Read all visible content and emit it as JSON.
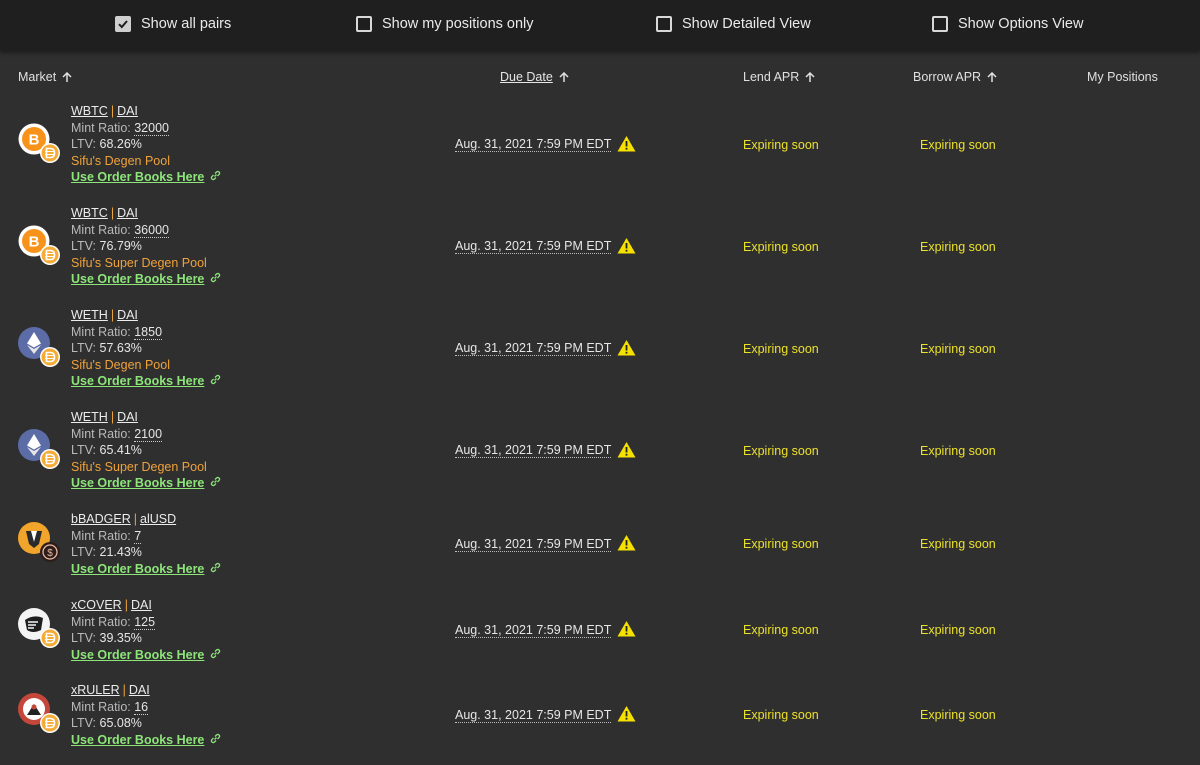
{
  "filters": [
    {
      "label": "Show all pairs",
      "checked": true
    },
    {
      "label": "Show my positions only",
      "checked": false
    },
    {
      "label": "Show Detailed View",
      "checked": false
    },
    {
      "label": "Show Options View",
      "checked": false
    }
  ],
  "columns": {
    "market": "Market",
    "due_date": "Due Date",
    "lend_apr": "Lend APR",
    "borrow_apr": "Borrow APR",
    "my_positions": "My Positions"
  },
  "rows": [
    {
      "base": "WBTC",
      "quote": "DAI",
      "mint_label": "Mint Ratio:",
      "mint_ratio": "32000",
      "ltv_label": "LTV:",
      "ltv": "68.26%",
      "pool": "Sifu's Degen Pool",
      "order_books": "Use Order Books Here",
      "due": "Aug. 31, 2021 7:59 PM EDT",
      "lend": "Expiring soon",
      "borrow": "Expiring soon",
      "base_icon": "bitcoin-icon",
      "quote_icon": "dai-icon"
    },
    {
      "base": "WBTC",
      "quote": "DAI",
      "mint_label": "Mint Ratio:",
      "mint_ratio": "36000",
      "ltv_label": "LTV:",
      "ltv": "76.79%",
      "pool": "Sifu's Super Degen Pool",
      "order_books": "Use Order Books Here",
      "due": "Aug. 31, 2021 7:59 PM EDT",
      "lend": "Expiring soon",
      "borrow": "Expiring soon",
      "base_icon": "bitcoin-icon",
      "quote_icon": "dai-icon"
    },
    {
      "base": "WETH",
      "quote": "DAI",
      "mint_label": "Mint Ratio:",
      "mint_ratio": "1850",
      "ltv_label": "LTV:",
      "ltv": "57.63%",
      "pool": "Sifu's Degen Pool",
      "order_books": "Use Order Books Here",
      "due": "Aug. 31, 2021 7:59 PM EDT",
      "lend": "Expiring soon",
      "borrow": "Expiring soon",
      "base_icon": "ethereum-icon",
      "quote_icon": "dai-icon"
    },
    {
      "base": "WETH",
      "quote": "DAI",
      "mint_label": "Mint Ratio:",
      "mint_ratio": "2100",
      "ltv_label": "LTV:",
      "ltv": "65.41%",
      "pool": "Sifu's Super Degen Pool",
      "order_books": "Use Order Books Here",
      "due": "Aug. 31, 2021 7:59 PM EDT",
      "lend": "Expiring soon",
      "borrow": "Expiring soon",
      "base_icon": "ethereum-icon",
      "quote_icon": "dai-icon"
    },
    {
      "base": "bBADGER",
      "quote": "alUSD",
      "mint_label": "Mint Ratio:",
      "mint_ratio": "7",
      "ltv_label": "LTV:",
      "ltv": "21.43%",
      "pool": "",
      "order_books": "Use Order Books Here",
      "due": "Aug. 31, 2021 7:59 PM EDT",
      "lend": "Expiring soon",
      "borrow": "Expiring soon",
      "base_icon": "badger-icon",
      "quote_icon": "alusd-icon"
    },
    {
      "base": "xCOVER",
      "quote": "DAI",
      "mint_label": "Mint Ratio:",
      "mint_ratio": "125",
      "ltv_label": "LTV:",
      "ltv": "39.35%",
      "pool": "",
      "order_books": "Use Order Books Here",
      "due": "Aug. 31, 2021 7:59 PM EDT",
      "lend": "Expiring soon",
      "borrow": "Expiring soon",
      "base_icon": "cover-icon",
      "quote_icon": "dai-icon"
    },
    {
      "base": "xRULER",
      "quote": "DAI",
      "mint_label": "Mint Ratio:",
      "mint_ratio": "16",
      "ltv_label": "LTV:",
      "ltv": "65.08%",
      "pool": "",
      "order_books": "Use Order Books Here",
      "due": "Aug. 31, 2021 7:59 PM EDT",
      "lend": "Expiring soon",
      "borrow": "Expiring soon",
      "base_icon": "ruler-icon",
      "quote_icon": "dai-icon"
    }
  ],
  "colors": {
    "background": "#2f2f2f",
    "topbar": "#1f1f1f",
    "pool": "#f0a23a",
    "order_books_link": "#8de57a",
    "expiring": "#ece12a",
    "warning": "#f5e000"
  }
}
